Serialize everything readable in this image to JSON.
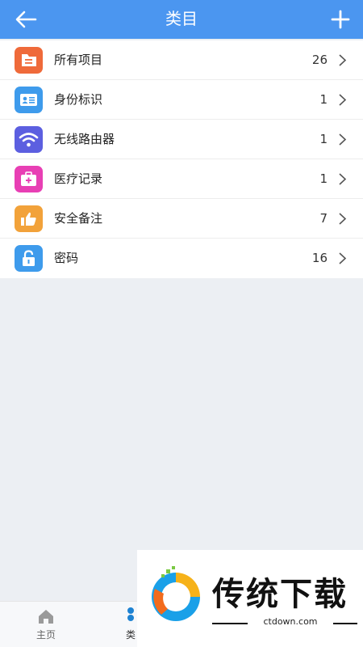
{
  "header": {
    "title": "类目",
    "back_icon": "arrow-left-icon",
    "add_icon": "plus-icon",
    "color": "#4b96f0"
  },
  "categories": [
    {
      "label": "所有项目",
      "count": "26",
      "icon": "folder-icon",
      "color": "#ef6a3a"
    },
    {
      "label": "身份标识",
      "count": "1",
      "icon": "id-card-icon",
      "color": "#3e9bec"
    },
    {
      "label": "无线路由器",
      "count": "1",
      "icon": "wifi-icon",
      "color": "#5c5fe0"
    },
    {
      "label": "医疗记录",
      "count": "1",
      "icon": "medical-kit-icon",
      "color": "#e83fb4"
    },
    {
      "label": "安全备注",
      "count": "7",
      "icon": "thumbs-up-icon",
      "color": "#f2a23a"
    },
    {
      "label": "密码",
      "count": "16",
      "icon": "lock-icon",
      "color": "#3e9bec"
    }
  ],
  "tabbar": {
    "tabs": [
      {
        "label": "主页",
        "icon": "home-icon"
      },
      {
        "label": "类",
        "icon": "category-icon"
      }
    ]
  },
  "watermark": {
    "brand": "传统下载",
    "domain": "ctdown.com"
  }
}
